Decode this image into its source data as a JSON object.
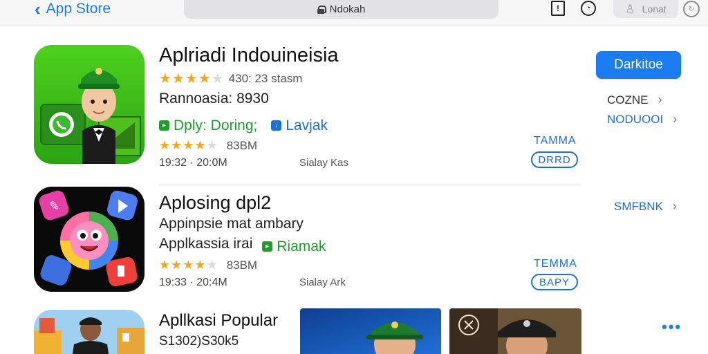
{
  "topbar": {
    "back_label": "App Store",
    "url": "Ndokah",
    "user_label": "Lonat"
  },
  "apps": [
    {
      "title": "Aplriadi Indouineisia",
      "rating_text": "430: 23 stasm",
      "line2": "Rannoasia: 8930",
      "badge1": "Dply: Doring;",
      "badge2": "Lavjak",
      "size": "83BM",
      "date": "19:32 · 20:0M",
      "meta_right": "Sialay Kas",
      "get_button": "Darkitoe",
      "side_link_1": "COZNE",
      "side_link_2": "NODUOOI",
      "tag": "TAMMA",
      "pill": "DRRD"
    },
    {
      "title": "Aplosing dpl2",
      "line2": "Appinpsie mat ambary",
      "line3": "Applkassia irai",
      "badge": "Riamak",
      "size": "83BM",
      "date": "19:33 · 20:4M",
      "meta_right": "Sialay Ark",
      "side_link": "SMFBNK",
      "tag": "TEMMA",
      "pill": "BAPY"
    },
    {
      "title": "Apllkasi Popular",
      "line2": "S1302)S30k5"
    }
  ],
  "colors": {
    "accent": "#1a7cf0",
    "star": "#f0a81c",
    "green": "#1e9e2a"
  }
}
